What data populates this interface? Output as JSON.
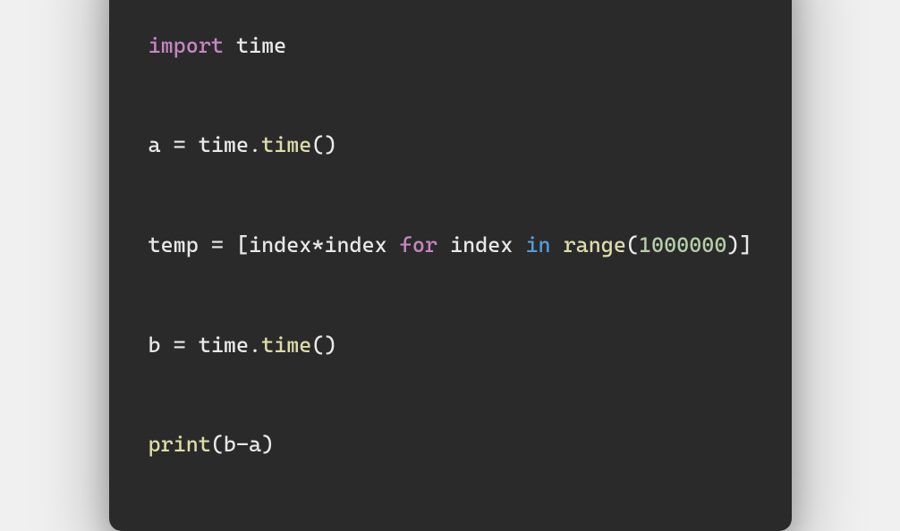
{
  "code": {
    "lines": [
      {
        "tokens": [
          {
            "text": "import",
            "cls": "tk-keyword"
          },
          {
            "text": " time",
            "cls": "tk-default"
          }
        ]
      },
      {
        "tokens": [
          {
            "text": "a = time.",
            "cls": "tk-default"
          },
          {
            "text": "time",
            "cls": "tk-func"
          },
          {
            "text": "()",
            "cls": "tk-default"
          }
        ]
      },
      {
        "tokens": [
          {
            "text": "temp = [index*index ",
            "cls": "tk-default"
          },
          {
            "text": "for",
            "cls": "tk-for"
          },
          {
            "text": " index ",
            "cls": "tk-default"
          },
          {
            "text": "in",
            "cls": "tk-in"
          },
          {
            "text": " ",
            "cls": "tk-default"
          },
          {
            "text": "range",
            "cls": "tk-func"
          },
          {
            "text": "(",
            "cls": "tk-default"
          },
          {
            "text": "1000000",
            "cls": "tk-num"
          },
          {
            "text": ")]",
            "cls": "tk-default"
          }
        ]
      },
      {
        "tokens": [
          {
            "text": "b = time.",
            "cls": "tk-default"
          },
          {
            "text": "time",
            "cls": "tk-func"
          },
          {
            "text": "()",
            "cls": "tk-default"
          }
        ]
      },
      {
        "tokens": [
          {
            "text": "print",
            "cls": "tk-func"
          },
          {
            "text": "(b-a)",
            "cls": "tk-default"
          }
        ]
      }
    ]
  }
}
